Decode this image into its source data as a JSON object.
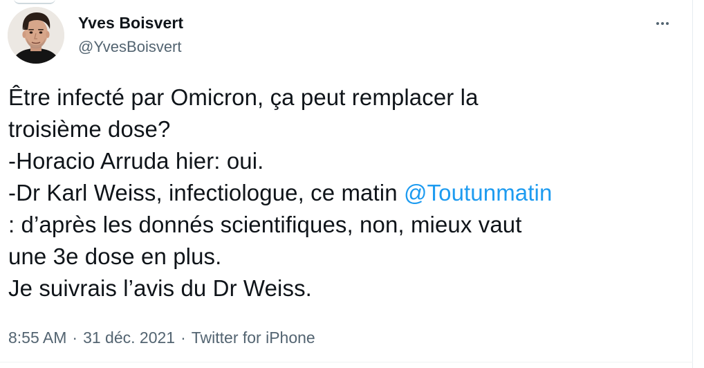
{
  "author": {
    "display_name": "Yves Boisvert",
    "handle": "@YvesBoisvert"
  },
  "icons": {
    "more": "more-horizontal-icon",
    "avatar": "profile-photo"
  },
  "tweet": {
    "lines": [
      {
        "text": "Être infecté par Omicron, ça peut remplacer la"
      },
      {
        "text": "troisième dose?"
      },
      {
        "text": "-Horacio Arruda hier: oui."
      },
      {
        "text": "-Dr Karl Weiss, infectiologue, ce matin ",
        "mention": "@Toutunmatin"
      },
      {
        "text": ": d’après les donnés scientifiques, non, mieux vaut"
      },
      {
        "text": "une 3e dose en plus."
      },
      {
        "text": "Je suivrais l’avis du Dr Weiss."
      }
    ]
  },
  "meta": {
    "time": "8:55 AM",
    "separator": "·",
    "date": "31 déc. 2021",
    "source": "Twitter for iPhone"
  },
  "colors": {
    "text": "#0f1419",
    "secondary": "#536471",
    "link": "#1d9bf0"
  }
}
